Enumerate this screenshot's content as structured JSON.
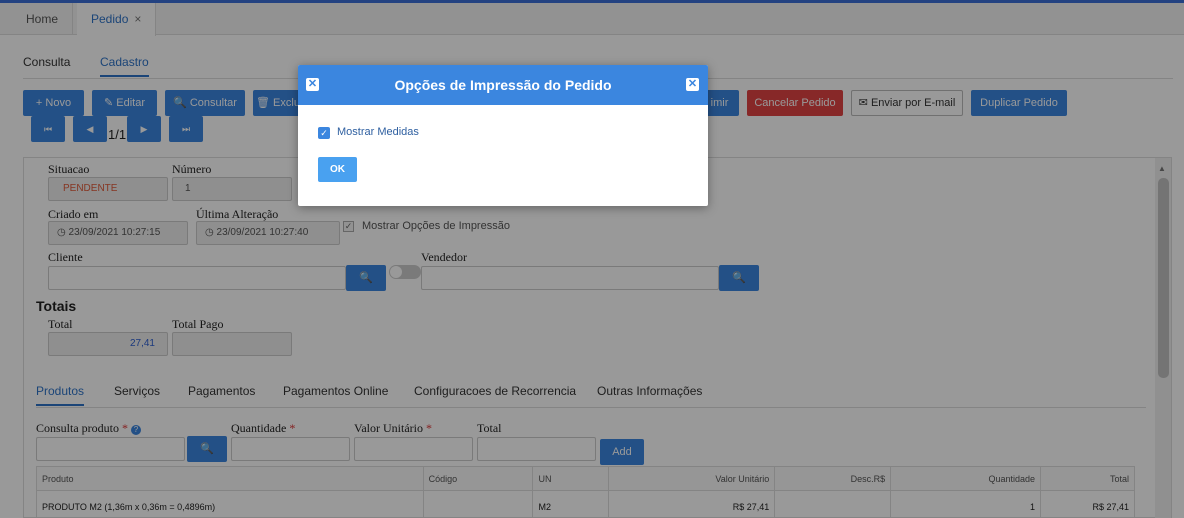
{
  "tabs": [
    {
      "label": "Home"
    },
    {
      "label": "Pedido",
      "close": "×"
    }
  ],
  "subtabs": {
    "consulta": "Consulta",
    "cadastro": "Cadastro"
  },
  "toolbar": {
    "novo": "+ Novo",
    "editar": "✎ Editar",
    "consultar": "🔍 Consultar",
    "excluir": "🗑 Exclu",
    "imprimir": "imir",
    "cancelar": "Cancelar Pedido",
    "email": "✉ Enviar por E-mail",
    "duplicar": "Duplicar Pedido"
  },
  "pager": "1/1",
  "form": {
    "situacao_label": "Situacao",
    "situacao_value": "PENDENTE",
    "numero_label": "Número",
    "numero_value": "1",
    "criado_label": "Criado em",
    "criado_value": "23/09/2021 10:27:15",
    "ultima_label": "Última Alteração",
    "ultima_value": "23/09/2021 10:27:40",
    "mostrar_opcoes": "Mostrar Opções de Impressão",
    "cliente_label": "Cliente",
    "vendedor_label": "Vendedor"
  },
  "totais": {
    "title": "Totais",
    "total_label": "Total",
    "total_value": "27,41",
    "pago_label": "Total Pago"
  },
  "product_tabs": [
    "Produtos",
    "Serviços",
    "Pagamentos",
    "Pagamentos Online",
    "Configuracoes de Recorrencia",
    "Outras Informações"
  ],
  "add_product": {
    "consulta_label": "Consulta produto",
    "quantidade_label": "Quantidade",
    "valor_label": "Valor Unitário",
    "total_label": "Total",
    "required_mark": "*",
    "add_button": "Add"
  },
  "table": {
    "headers": [
      "Produto",
      "Código",
      "UN",
      "Valor Unitário",
      "Desc.R$",
      "Quantidade",
      "Total"
    ],
    "rows": [
      [
        "PRODUTO M2 (1,36m x 0,36m = 0,4896m)",
        "",
        "M2",
        "R$ 27,41",
        "",
        "1",
        "R$ 27,41"
      ]
    ]
  },
  "modal": {
    "title": "Opções de Impressão do Pedido",
    "close_glyph": "✕",
    "checkbox_label": "Mostrar Medidas",
    "checkbox_checked": true,
    "ok": "OK"
  },
  "colors": {
    "primary": "#3b86df",
    "danger": "#e14444",
    "status_pending": "#e05a3a"
  }
}
